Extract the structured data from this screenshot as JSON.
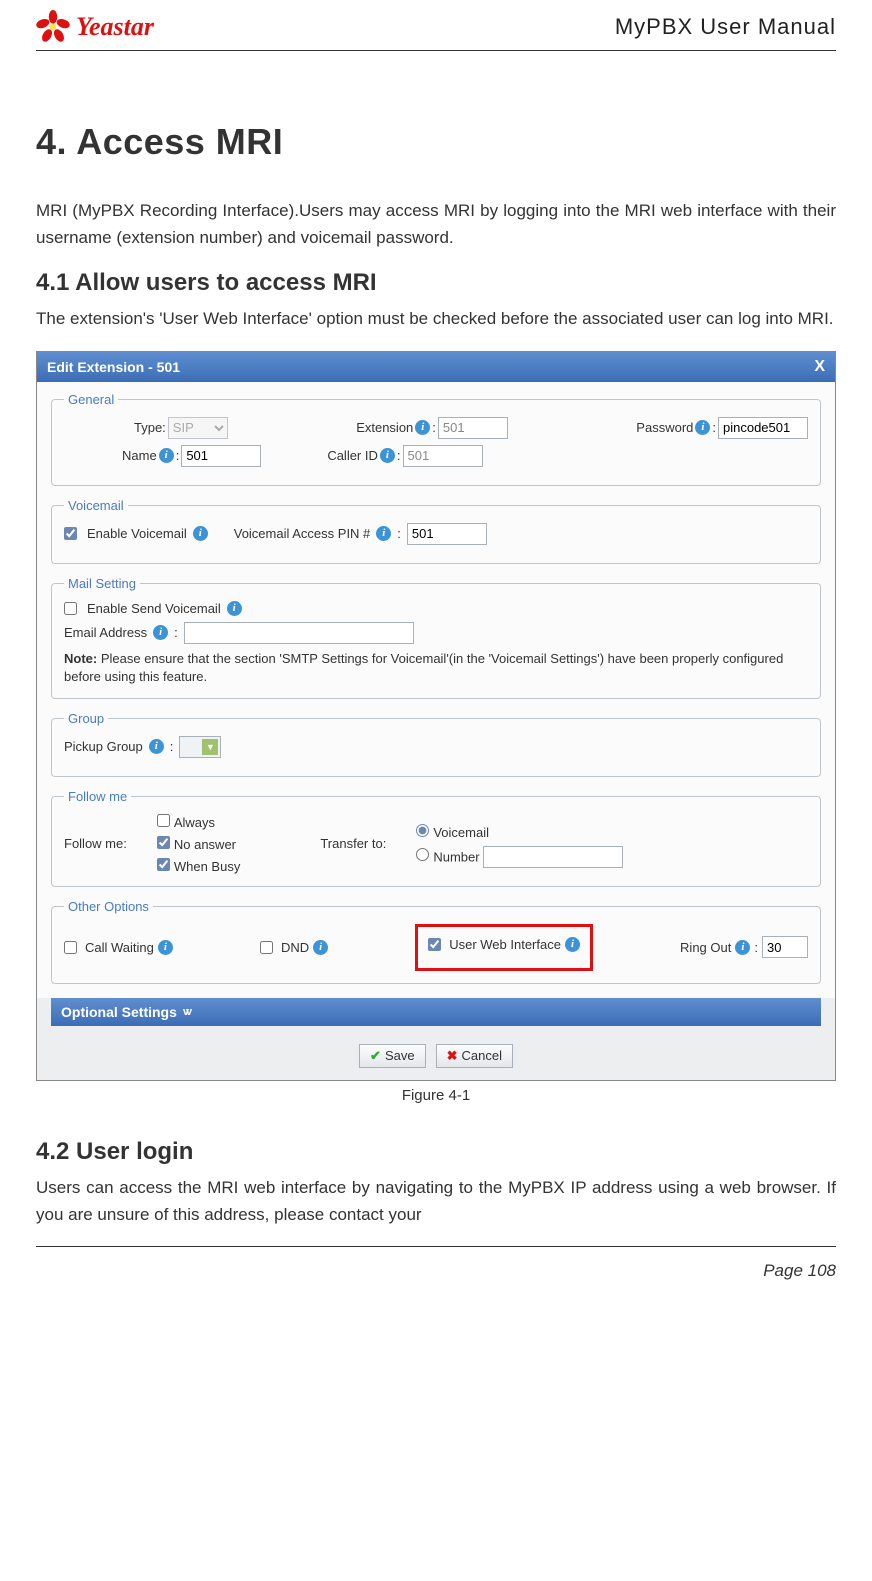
{
  "header": {
    "brand": "Yeastar",
    "doc_title": "MyPBX User Manual"
  },
  "section": {
    "h1": "4. Access MRI",
    "intro": "MRI (MyPBX Recording Interface).Users may access MRI by logging into the MRI web interface with their username (extension number) and voicemail password.",
    "h2a": "4.1 Allow users to access MRI",
    "p2": "The extension's 'User Web Interface' option must be checked before the associated user can log into MRI.",
    "fig_caption": "Figure 4-1",
    "h2b": "4.2 User login",
    "p3": "Users can access the MRI web interface by navigating to the MyPBX IP address using a web browser. If you are unsure of this address, please contact your"
  },
  "dialog": {
    "title": "Edit Extension - 501",
    "close": "X",
    "general": {
      "legend": "General",
      "type_label": "Type:",
      "type_value": "SIP",
      "ext_label": "Extension",
      "ext_value": "501",
      "pass_label": "Password",
      "pass_value": "pincode501",
      "name_label": "Name",
      "name_value": "501",
      "cid_label": "Caller ID",
      "cid_value": "501"
    },
    "voicemail": {
      "legend": "Voicemail",
      "enable_label": "Enable Voicemail",
      "pin_label": "Voicemail Access PIN #",
      "pin_value": "501"
    },
    "mail": {
      "legend": "Mail Setting",
      "enable_label": "Enable Send Voicemail",
      "email_label": "Email Address",
      "note": "Note: Please ensure that the section 'SMTP Settings for Voicemail'(in the 'Voicemail Settings') have been properly configured before using this feature."
    },
    "group": {
      "legend": "Group",
      "label": "Pickup Group"
    },
    "follow": {
      "legend": "Follow me",
      "label": "Follow me:",
      "always": "Always",
      "noanswer": "No answer",
      "busy": "When Busy",
      "transfer_label": "Transfer to:",
      "voicemail": "Voicemail",
      "number": "Number"
    },
    "other": {
      "legend": "Other Options",
      "callwaiting": "Call Waiting",
      "dnd": "DND",
      "uwi": "User Web Interface",
      "ringout_label": "Ring Out",
      "ringout_value": "30"
    },
    "optional_bar": "Optional Settings",
    "save": "Save",
    "cancel": "Cancel"
  },
  "footer": {
    "page": "Page 108"
  }
}
